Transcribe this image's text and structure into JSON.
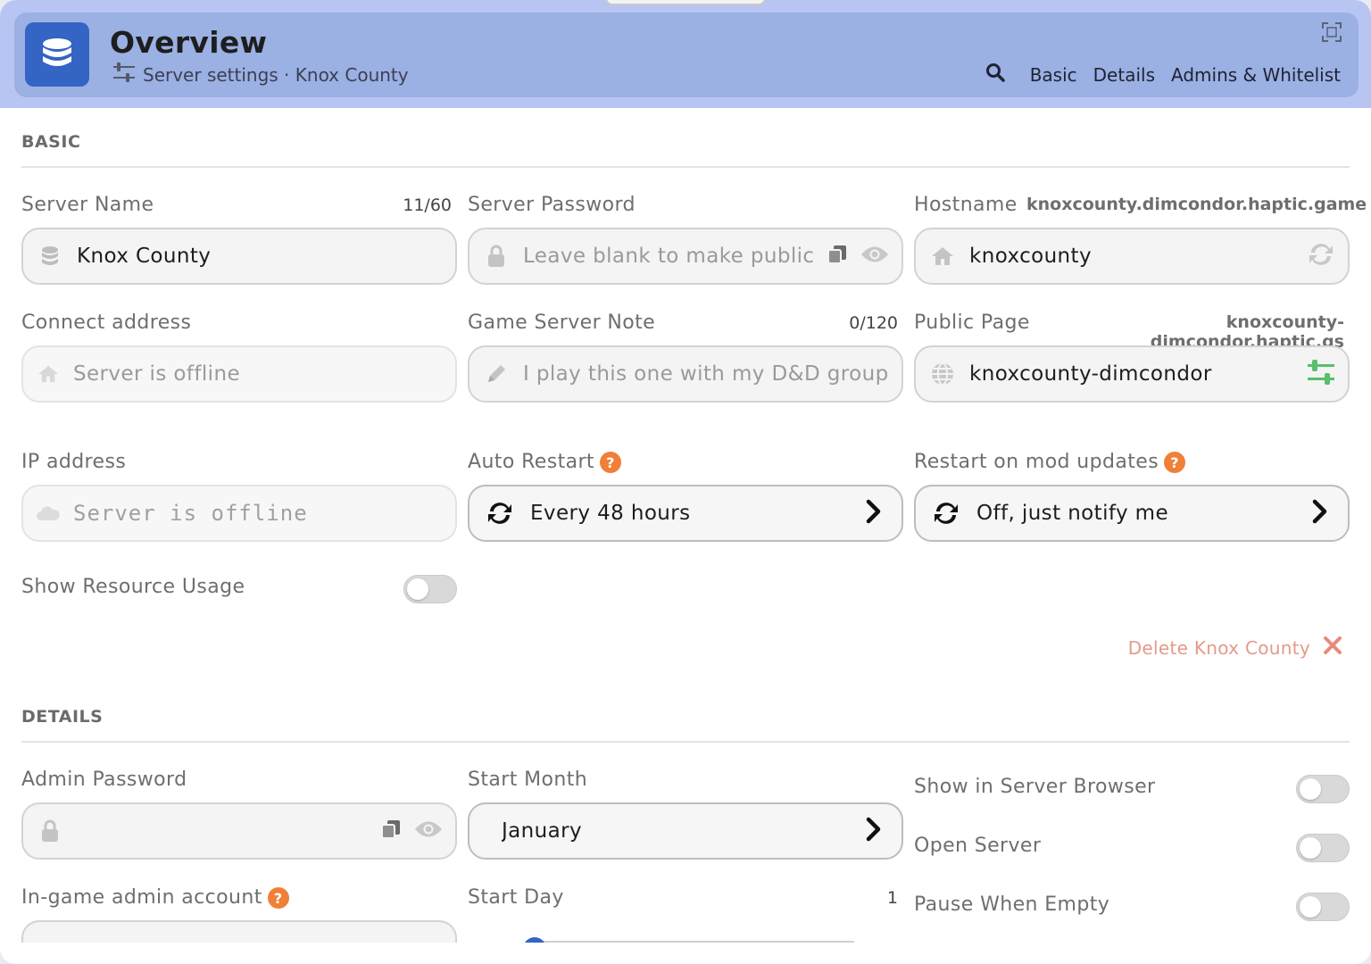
{
  "header": {
    "title": "Overview",
    "subtitle": "Server settings · Knox County",
    "nav": [
      "Basic",
      "Details",
      "Admins & Whitelist"
    ],
    "colors": {
      "band": "#b8c5f3",
      "bar": "#9bb0e3",
      "app_icon": "#3464c4"
    }
  },
  "basic": {
    "section_title": "BASIC",
    "server_name": {
      "label": "Server Name",
      "counter": "11/60",
      "value": "Knox County",
      "icon": "database-icon"
    },
    "server_password": {
      "label": "Server Password",
      "placeholder": "Leave blank to make public",
      "icon": "lock-icon"
    },
    "hostname": {
      "label": "Hostname",
      "domain": "knoxcounty.dimcondor.haptic.game",
      "value": "knoxcounty",
      "icon": "home-icon"
    },
    "connect_address": {
      "label": "Connect address",
      "value": "Server is offline",
      "icon": "home-icon"
    },
    "game_server_note": {
      "label": "Game Server Note",
      "counter": "0/120",
      "placeholder": "I play this one with my D&D group",
      "icon": "pencil-icon"
    },
    "public_page": {
      "label": "Public Page",
      "domain": "knoxcounty-dimcondor.haptic.gs",
      "value": "knoxcounty-dimcondor",
      "icon": "globe-icon"
    },
    "ip_address": {
      "label": "IP address",
      "value": "Server is offline",
      "icon": "cloud-icon"
    },
    "auto_restart": {
      "label": "Auto Restart",
      "value": "Every 48 hours"
    },
    "restart_on_mod_updates": {
      "label": "Restart on mod updates",
      "value": "Off, just notify me"
    },
    "show_resource_usage": {
      "label": "Show Resource Usage",
      "on": false
    },
    "delete_label": "Delete Knox County"
  },
  "details": {
    "section_title": "DETAILS",
    "admin_password": {
      "label": "Admin Password",
      "value": ""
    },
    "start_month": {
      "label": "Start Month",
      "value": "January"
    },
    "show_in_server_browser": {
      "label": "Show in Server Browser",
      "on": false
    },
    "open_server": {
      "label": "Open Server",
      "on": false
    },
    "in_game_admin_account": {
      "label": "In-game admin account"
    },
    "start_day": {
      "label": "Start Day",
      "value": "1",
      "fraction": 0
    },
    "pause_when_empty": {
      "label": "Pause When Empty",
      "on": false
    }
  },
  "colors": {
    "help_badge": "#f07f38",
    "delete_text": "#e49a8a",
    "delete_icon": "#e88a7b",
    "public_page_icon": "#56c06a"
  }
}
